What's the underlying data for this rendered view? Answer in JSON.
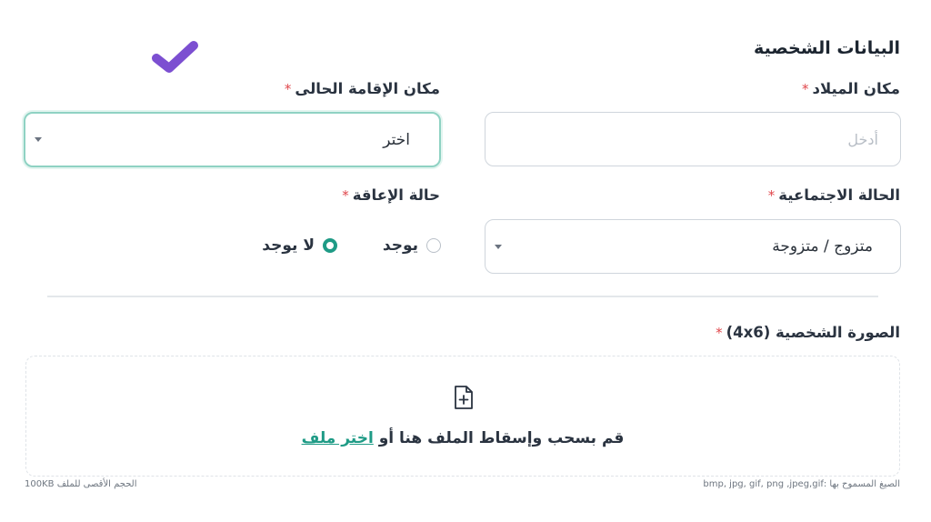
{
  "section": {
    "title": "البيانات الشخصية"
  },
  "birth_place": {
    "label": "مكان الميلاد",
    "required_mark": "*",
    "placeholder": "أدخل"
  },
  "residence": {
    "label": "مكان الإقامة الحالى",
    "required_mark": "*",
    "value": "اختر"
  },
  "marital_status": {
    "label": "الحالة الاجتماعية",
    "required_mark": "*",
    "value": "متزوج / متزوجة"
  },
  "disability": {
    "label": "حالة الإعاقة",
    "required_mark": "*",
    "options": [
      {
        "label": "يوجد",
        "selected": false
      },
      {
        "label": "لا يوجد",
        "selected": true
      }
    ]
  },
  "photo": {
    "label": "الصورة الشخصية (4x6)",
    "required_mark": "*",
    "drop_text": "قم بسحب وإسقاط الملف هنا أو",
    "choose_link": "اختر ملف",
    "allowed_formats": "الصيغ المسموح بها :bmp, jpg, gif, png ,jpeg,gif",
    "max_size": "الحجم الأقصى للملف 100KB"
  },
  "colors": {
    "accent": "#1f9b86",
    "required": "#e0474c",
    "check": "#7c4fd1"
  },
  "icons": {
    "checkmark": "check-icon",
    "file_add": "file-plus-icon",
    "dropdown": "chevron-down-icon"
  }
}
